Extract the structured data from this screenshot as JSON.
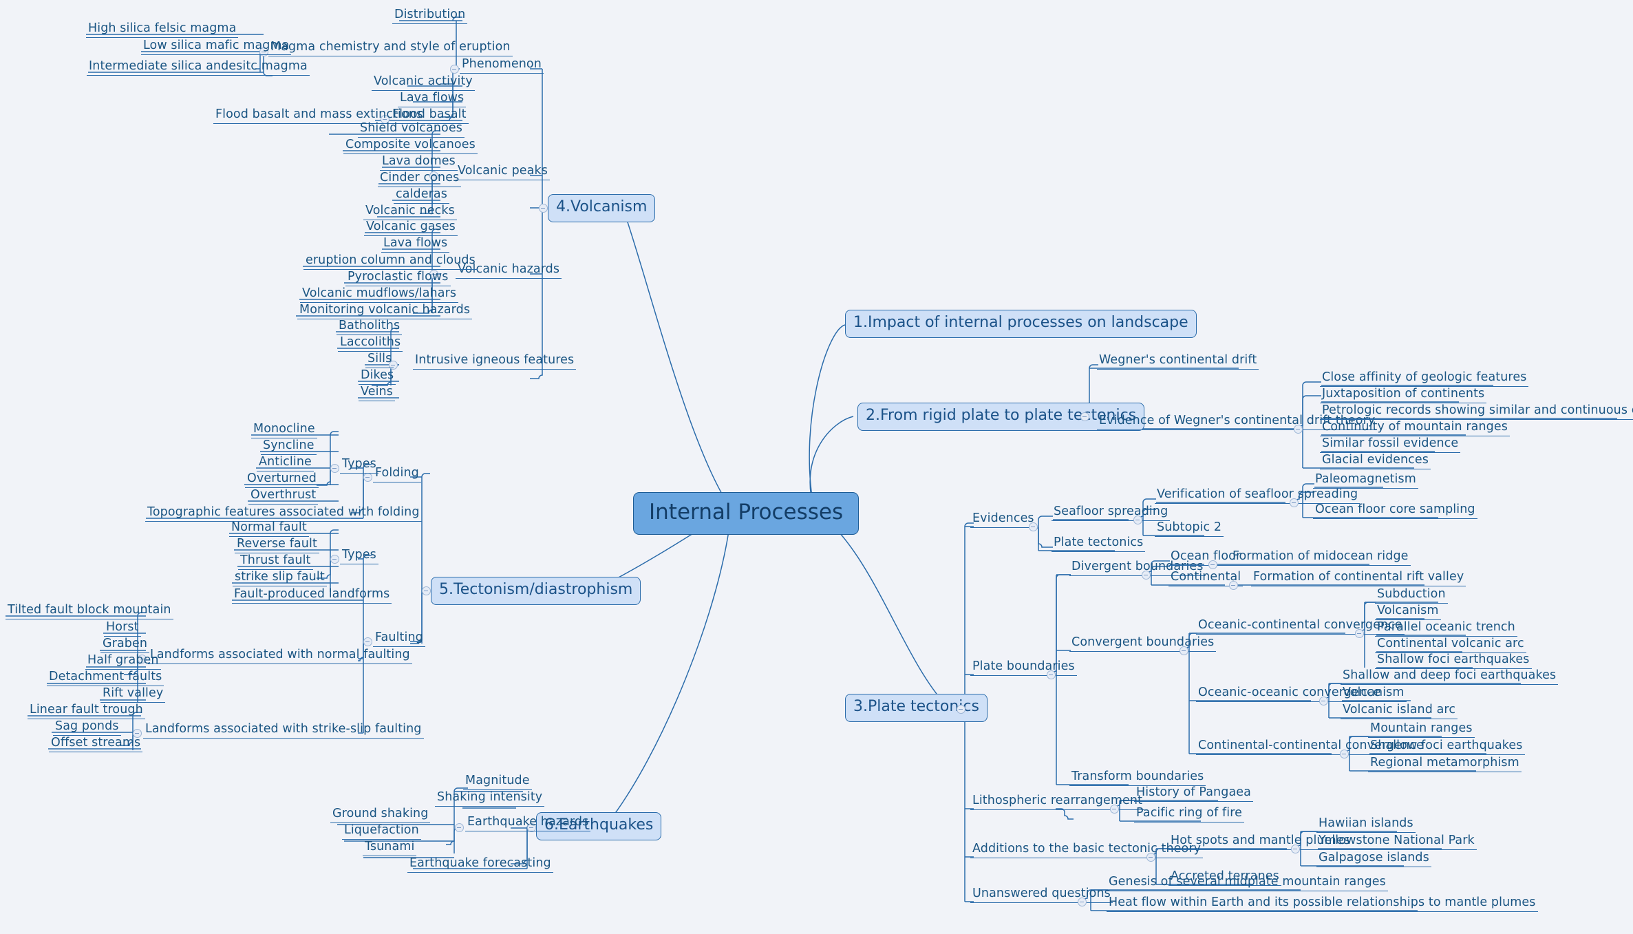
{
  "title": "Internal Processes",
  "colors": {
    "background": "#f1f3f8",
    "root_fill": "#6aa6e0",
    "root_stroke": "#1d5c96",
    "main_fill": "#cfe0f7",
    "main_stroke": "#2b6cab",
    "text": "#1a5583",
    "edge": "#2b6cab",
    "toggle_fill": "#e6ecf6",
    "toggle_stroke": "#9db6d6"
  },
  "root": {
    "label": "Internal Processes"
  },
  "branches": {
    "impact": {
      "label": "1.Impact of internal processes on landscape"
    },
    "rigid_plate": {
      "label": "2.From rigid plate to plate tectonics",
      "children": {
        "wegner": "Wegner's continental drift",
        "evidence": "Evidence of Wegner's continental drift theory",
        "evidence_items": [
          "Close affinity of geologic features",
          "Juxtaposition of continents",
          "Petrologic records showing similar and continuous coal deposits",
          "Continuity of mountain ranges",
          "Similar fossil evidence",
          "Glacial evidences"
        ]
      }
    },
    "plate_tectonics": {
      "label": "3.Plate tectonics",
      "evidences": {
        "label": "Evidences",
        "seafloor_spreading": {
          "label": "Seafloor spreading",
          "verification": "Verification of seafloor spreading",
          "verification_items": [
            "Paleomagnetism",
            "Ocean floor core sampling"
          ],
          "subtopic": "Subtopic 2"
        },
        "plate_tectonics_item": "Plate tectonics"
      },
      "plate_boundaries": {
        "label": "Plate boundaries",
        "divergent": {
          "label": "Divergent boundaries",
          "ocean_floor": "Ocean floor",
          "ocean_floor_item": "Formation of midocean ridge",
          "continental": "Continental",
          "continental_item": "Formation of continental rift valley"
        },
        "convergent": {
          "label": "Convergent boundaries",
          "oceanic_continental": {
            "label": "Oceanic-continental convergence",
            "items": [
              "Subduction",
              "Volcanism",
              "Parallel oceanic trench",
              "Continental volcanic arc",
              "Shallow foci earthquakes"
            ]
          },
          "oceanic_oceanic": {
            "label": "Oceanic-oceanic convergence",
            "items": [
              "Shallow and deep foci earthquakes",
              "Volcanism",
              "Volcanic island arc"
            ]
          },
          "continental_continental": {
            "label": "Continental-continental convergence",
            "items": [
              "Mountain ranges",
              "Shallow foci earthquakes",
              "Regional metamorphism"
            ]
          }
        },
        "transform": "Transform boundaries"
      },
      "lithospheric": {
        "label": "Lithospheric rearrangement",
        "items": [
          "History of Pangaea",
          "Pacific ring of fire"
        ]
      },
      "additions": {
        "label": "Additions to the basic tectonic theory",
        "hot_spots": {
          "label": "Hot spots and mantle plumes",
          "items": [
            "Hawiian islands",
            "Yellowstone National Park",
            "Galpagose islands"
          ]
        },
        "accreted": "Accreted terranes"
      },
      "unanswered": {
        "label": "Unanswered questions",
        "items": [
          "Genesis of several midplate mountain ranges",
          "Heat flow within Earth and its possible relationships to mantle plumes"
        ]
      }
    },
    "volcanism": {
      "label": "4.Volcanism",
      "phenomenon": {
        "label": "Phenomenon",
        "distribution": "Distribution",
        "magma_chemistry": {
          "label": "Magma chemistry and style of eruption",
          "items": [
            "High silica felsic magma",
            "Low silica mafic magma",
            "Intermediate silica andesitc magma"
          ]
        },
        "volcanic_activity": "Volcanic activity",
        "lava_flows": "Lava flows",
        "flood_basalt": "Flood basalt",
        "flood_basalt_item": "Flood basalt and mass extinctions"
      },
      "volcanic_peaks": {
        "label": "Volcanic peaks",
        "items": [
          "Shield volcanoes",
          "Composite volcanoes",
          "Lava domes",
          "Cinder cones",
          "calderas",
          "Volcanic necks"
        ]
      },
      "volcanic_hazards": {
        "label": "Volcanic hazards",
        "items": [
          "Volcanic gases",
          "Lava flows",
          "eruption column and clouds",
          "Pyroclastic flows",
          "Volcanic mudflows/lahars",
          "Monitoring volcanic hazards"
        ]
      },
      "intrusive": {
        "label": "Intrusive igneous features",
        "items": [
          "Batholiths",
          "Laccoliths",
          "Sills",
          "Dikes",
          "Veins"
        ]
      }
    },
    "tectonism": {
      "label": "5.Tectonism/diastrophism",
      "folding": {
        "label": "Folding",
        "types": {
          "label": "Types",
          "items": [
            "Monocline",
            "Syncline",
            "Anticline",
            "Overturned",
            "Overthrust"
          ]
        },
        "topographic": "Topographic features associated with folding"
      },
      "faulting": {
        "label": "Faulting",
        "types": {
          "label": "Types",
          "items": [
            "Normal fault",
            "Reverse fault",
            "Thrust fault",
            "strike slip fault"
          ]
        },
        "fault_produced": "Fault-produced landforms",
        "normal_faulting": {
          "label": "Landforms associated with normal faulting",
          "items": [
            "Tilted fault block mountain",
            "Horst",
            "Graben",
            "Half graben",
            "Detachment faults",
            "Rift valley"
          ]
        },
        "strike_slip_faulting": {
          "label": "Landforms associated with strike-slip faulting",
          "items": [
            "Linear fault trough",
            "Sag ponds",
            "Offset streams"
          ]
        }
      }
    },
    "earthquakes": {
      "label": "6.Earthquakes",
      "hazards": {
        "label": "Earthquake hazards",
        "items": [
          "Magnitude",
          "Shaking intensity",
          "Ground shaking",
          "Liquefaction",
          "Tsunami"
        ]
      },
      "forecasting": "Earthquake forecasting"
    }
  }
}
